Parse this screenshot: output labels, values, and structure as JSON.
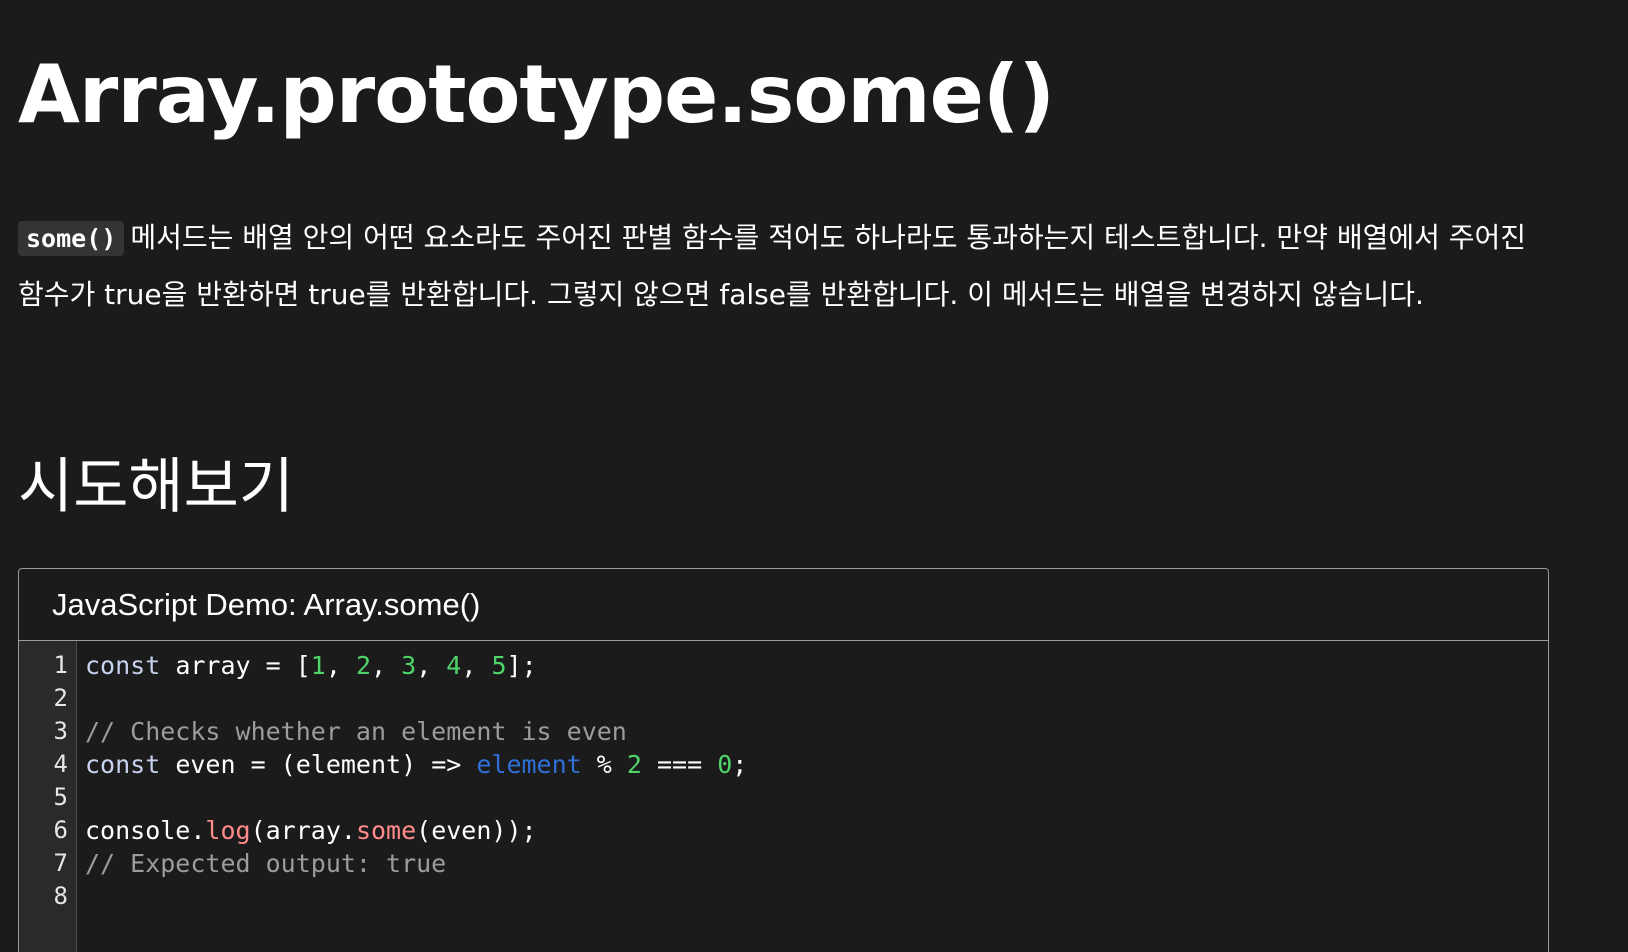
{
  "page": {
    "title": "Array.prototype.some()",
    "intro": {
      "code": "some()",
      "text": "메서드는 배열 안의 어떤 요소라도 주어진 판별 함수를 적어도 하나라도 통과하는지 테스트합니다. 만약 배열에서 주어진 함수가 true을 반환하면 true를 반환합니다. 그렇지 않으면 false를 반환합니다. 이 메서드는 배열을 변경하지 않습니다."
    },
    "section_title": "시도해보기"
  },
  "demo": {
    "title": "JavaScript Demo: Array.some()",
    "line_numbers": [
      "1",
      "2",
      "3",
      "4",
      "5",
      "6",
      "7",
      "8"
    ],
    "lines": {
      "l1": {
        "kw": "const",
        "name": " array = [",
        "n1": "1",
        "s1": ", ",
        "n2": "2",
        "s2": ", ",
        "n3": "3",
        "s3": ", ",
        "n4": "4",
        "s4": ", ",
        "n5": "5",
        "end": "];"
      },
      "l3": {
        "comment": "// Checks whether an element is even"
      },
      "l4": {
        "kw": "const",
        "mid": " even = (element) => ",
        "var": "element",
        "op": " % ",
        "n1": "2",
        "op2": " === ",
        "n2": "0",
        "end": ";"
      },
      "l6": {
        "obj": "console.",
        "fn1": "log",
        "mid": "(array.",
        "fn2": "some",
        "end": "(even));"
      },
      "l7": {
        "comment": "// Expected output: true"
      }
    }
  }
}
